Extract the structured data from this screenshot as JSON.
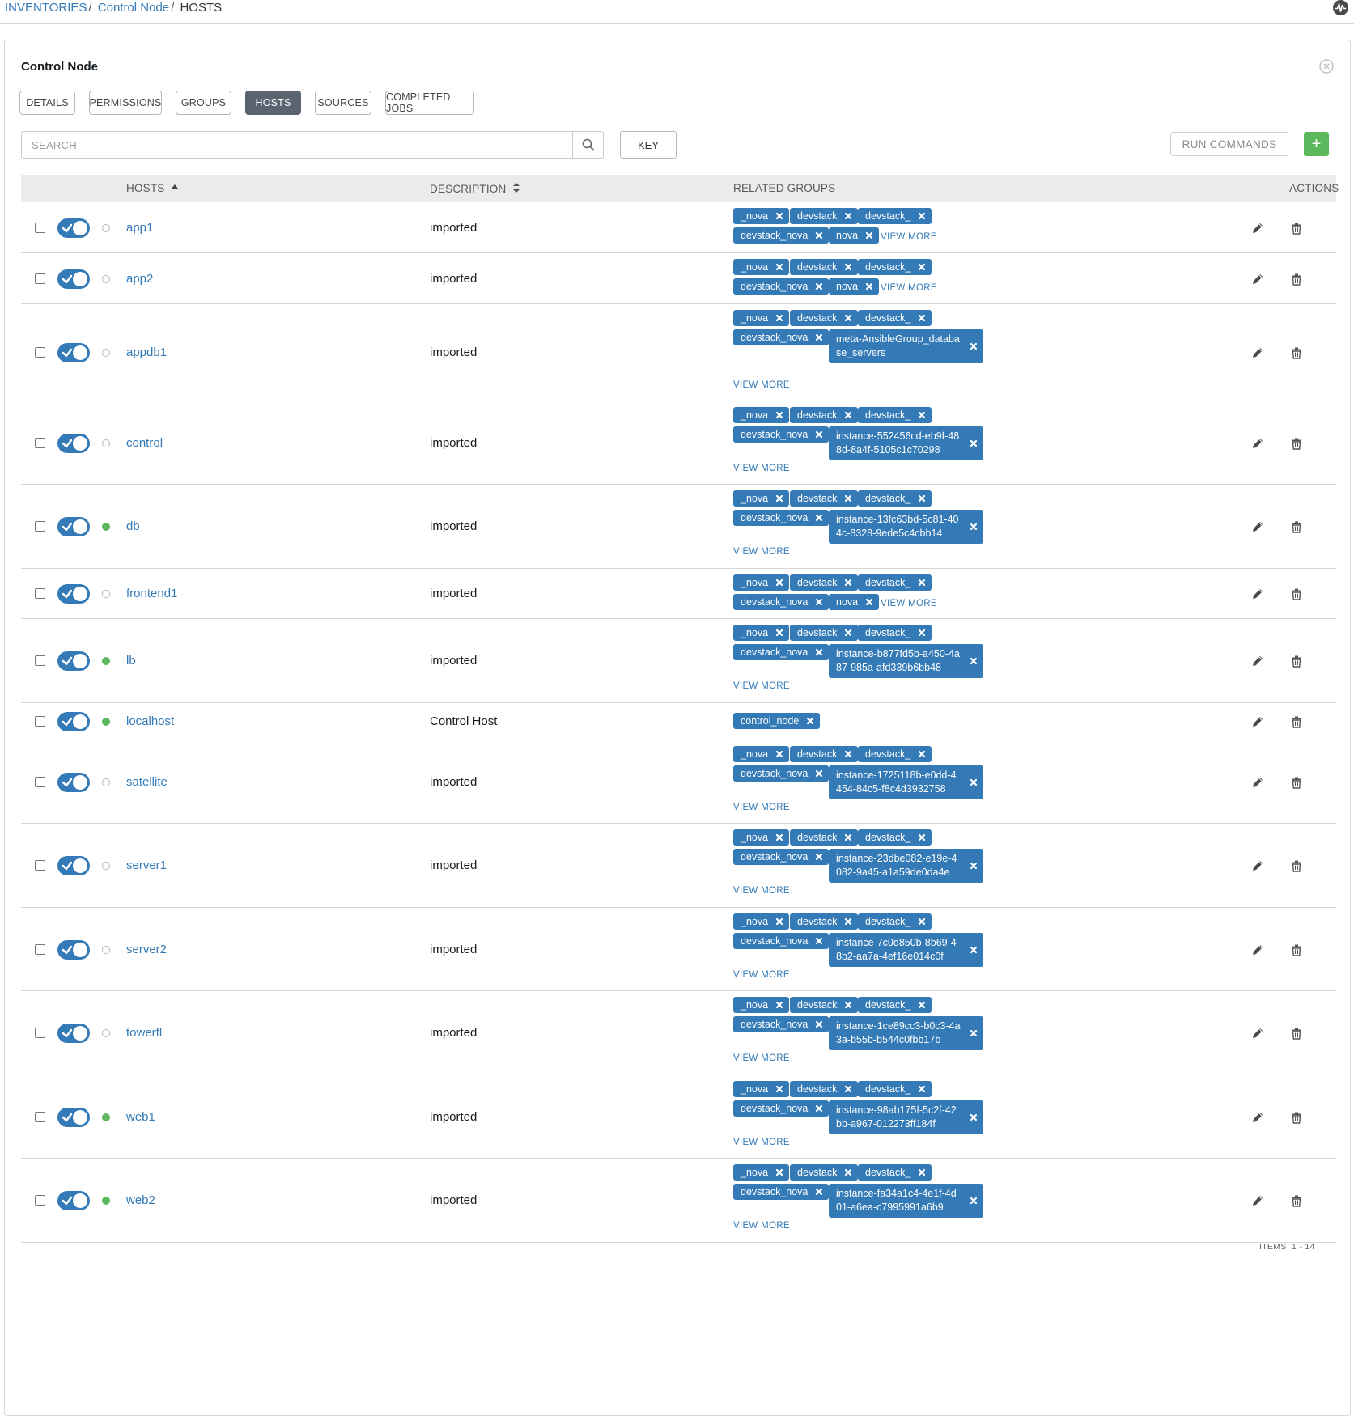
{
  "breadcrumb": {
    "inventories": "INVENTORIES",
    "inventory": "Control Node",
    "current": "HOSTS"
  },
  "panel": {
    "title": "Control Node"
  },
  "tabs": [
    {
      "label": "DETAILS"
    },
    {
      "label": "PERMISSIONS"
    },
    {
      "label": "GROUPS"
    },
    {
      "label": "HOSTS",
      "active": true
    },
    {
      "label": "SOURCES"
    },
    {
      "label": "COMPLETED JOBS"
    }
  ],
  "search": {
    "placeholder": "SEARCH",
    "key_label": "KEY"
  },
  "toolbar": {
    "run_commands": "RUN COMMANDS",
    "add": "+"
  },
  "colors": {
    "accent": "#337ab7",
    "success": "#5cb85c",
    "active_tab": "#5a6470"
  },
  "table": {
    "headers": {
      "hosts": "HOSTS",
      "description": "DESCRIPTION",
      "related_groups": "RELATED GROUPS",
      "actions": "ACTIONS"
    },
    "rows": [
      {
        "name": "app1",
        "enabled": true,
        "status": "off",
        "description": "imported",
        "groups": [
          "_nova",
          "devstack",
          "devstack_",
          "devstack_nova",
          "nova"
        ],
        "view_more": "VIEW MORE"
      },
      {
        "name": "app2",
        "enabled": true,
        "status": "off",
        "description": "imported",
        "groups": [
          "_nova",
          "devstack",
          "devstack_",
          "devstack_nova",
          "nova"
        ],
        "view_more": "VIEW MORE"
      },
      {
        "name": "appdb1",
        "enabled": true,
        "status": "off",
        "description": "imported",
        "groups": [
          "_nova",
          "devstack",
          "devstack_",
          "devstack_nova",
          "meta-AnsibleGroup_database_servers"
        ],
        "view_more": "VIEW MORE"
      },
      {
        "name": "control",
        "enabled": true,
        "status": "off",
        "description": "imported",
        "groups": [
          "_nova",
          "devstack",
          "devstack_",
          "devstack_nova",
          "instance-552456cd-eb9f-488d-8a4f-5105c1c70298"
        ],
        "view_more": "VIEW MORE"
      },
      {
        "name": "db",
        "enabled": true,
        "status": "on",
        "description": "imported",
        "groups": [
          "_nova",
          "devstack",
          "devstack_",
          "devstack_nova",
          "instance-13fc63bd-5c81-404c-8328-9ede5c4cbb14"
        ],
        "view_more": "VIEW MORE"
      },
      {
        "name": "frontend1",
        "enabled": true,
        "status": "off",
        "description": "imported",
        "groups": [
          "_nova",
          "devstack",
          "devstack_",
          "devstack_nova",
          "nova"
        ],
        "view_more": "VIEW MORE"
      },
      {
        "name": "lb",
        "enabled": true,
        "status": "on",
        "description": "imported",
        "groups": [
          "_nova",
          "devstack",
          "devstack_",
          "devstack_nova",
          "instance-b877fd5b-a450-4a87-985a-afd339b6bb48"
        ],
        "view_more": "VIEW MORE"
      },
      {
        "name": "localhost",
        "enabled": true,
        "status": "on",
        "description": "Control Host",
        "groups": [
          "control_node"
        ],
        "view_more": ""
      },
      {
        "name": "satellite",
        "enabled": true,
        "status": "off",
        "description": "imported",
        "groups": [
          "_nova",
          "devstack",
          "devstack_",
          "devstack_nova",
          "instance-1725118b-e0dd-4454-84c5-f8c4d3932758"
        ],
        "view_more": "VIEW MORE"
      },
      {
        "name": "server1",
        "enabled": true,
        "status": "off",
        "description": "imported",
        "groups": [
          "_nova",
          "devstack",
          "devstack_",
          "devstack_nova",
          "instance-23dbe082-e19e-4082-9a45-a1a59de0da4e"
        ],
        "view_more": "VIEW MORE"
      },
      {
        "name": "server2",
        "enabled": true,
        "status": "off",
        "description": "imported",
        "groups": [
          "_nova",
          "devstack",
          "devstack_",
          "devstack_nova",
          "instance-7c0d850b-8b69-48b2-aa7a-4ef16e014c0f"
        ],
        "view_more": "VIEW MORE"
      },
      {
        "name": "towerfl",
        "enabled": true,
        "status": "off",
        "description": "imported",
        "groups": [
          "_nova",
          "devstack",
          "devstack_",
          "devstack_nova",
          "instance-1ce89cc3-b0c3-4a3a-b55b-b544c0fbb17b"
        ],
        "view_more": "VIEW MORE"
      },
      {
        "name": "web1",
        "enabled": true,
        "status": "on",
        "description": "imported",
        "groups": [
          "_nova",
          "devstack",
          "devstack_",
          "devstack_nova",
          "instance-98ab175f-5c2f-42bb-a967-012273ff184f"
        ],
        "view_more": "VIEW MORE"
      },
      {
        "name": "web2",
        "enabled": true,
        "status": "on",
        "description": "imported",
        "groups": [
          "_nova",
          "devstack",
          "devstack_",
          "devstack_nova",
          "instance-fa34a1c4-4e1f-4d01-a6ea-c7995991a6b9"
        ],
        "view_more": "VIEW MORE"
      }
    ]
  },
  "footer": {
    "items_label": "ITEMS",
    "items_range": "1 - 14"
  }
}
